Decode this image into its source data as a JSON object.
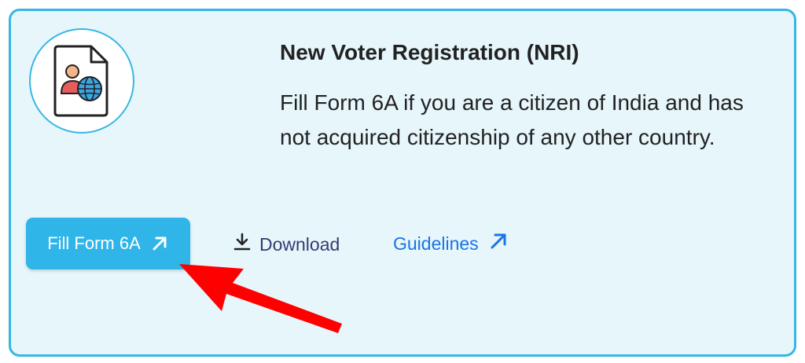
{
  "card": {
    "title": "New Voter Registration (NRI)",
    "description": "Fill Form 6A if you are a citizen of India and has not acquired citizenship of any other country.",
    "icon": "nri-document-globe-icon"
  },
  "actions": {
    "fill_form_label": "Fill Form 6A",
    "fill_form_icon": "external-arrow-icon",
    "download_label": "Download",
    "download_icon": "download-icon",
    "guidelines_label": "Guidelines",
    "guidelines_icon": "external-arrow-icon"
  },
  "annotation": {
    "type": "red-pointer-arrow",
    "color": "#ff0000",
    "points_to": "Fill Form 6A"
  },
  "colors": {
    "card_background": "#e6f6fb",
    "card_border": "#36b7e3",
    "primary_button": "#2fb5e8",
    "link_blue": "#1a73e8",
    "download_text": "#333b73"
  }
}
